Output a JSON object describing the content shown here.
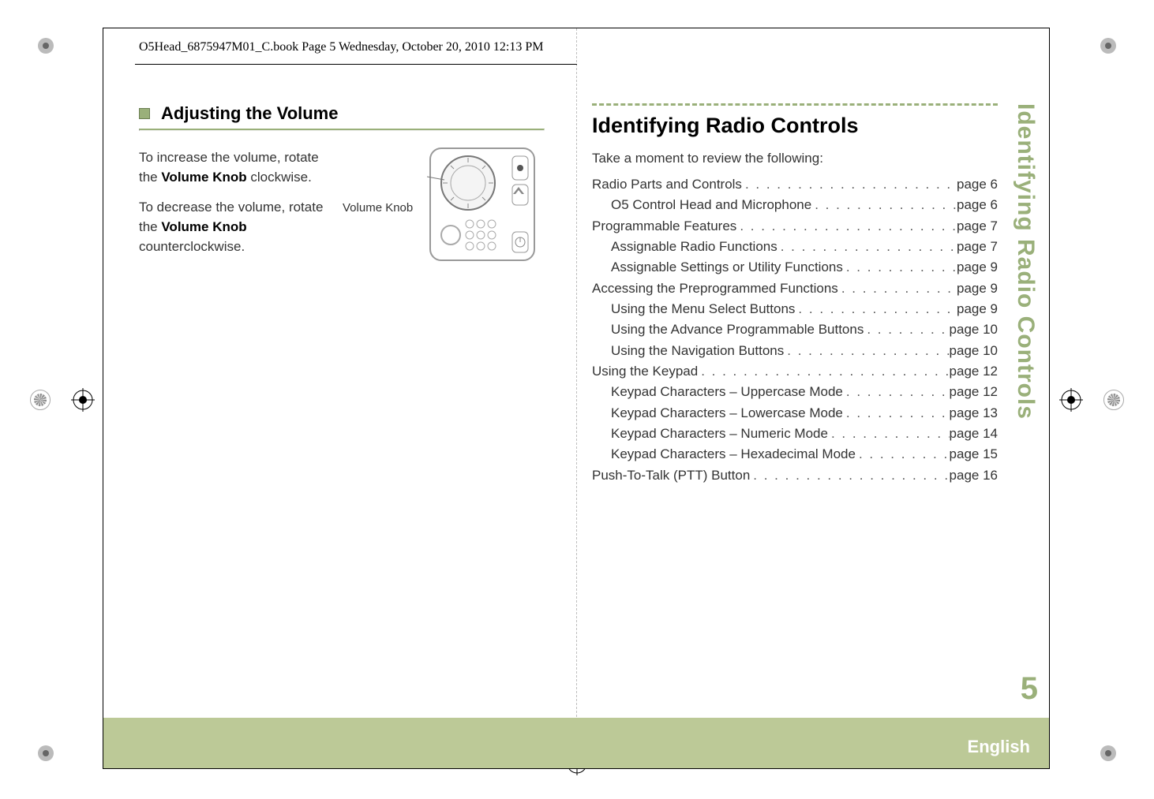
{
  "book_header": "O5Head_6875947M01_C.book  Page 5  Wednesday, October 20, 2010  12:13 PM",
  "left": {
    "heading": "Adjusting the Volume",
    "para1_a": "To increase the volume, rotate the ",
    "para1_b": "Volume Knob",
    "para1_c": " clockwise.",
    "para2_a": "To decrease the volume, rotate the ",
    "para2_b": "Volume Knob",
    "para2_c": " counterclockwise.",
    "knob_label": "Volume Knob"
  },
  "right": {
    "heading": "Identifying Radio Controls",
    "intro": "Take a moment to review the following:",
    "toc": [
      {
        "title": "Radio Parts and Controls",
        "page": "page 6",
        "indent": false
      },
      {
        "title": "O5 Control Head and Microphone",
        "page": "page 6",
        "indent": true
      },
      {
        "title": "Programmable Features",
        "page": "page 7",
        "indent": false
      },
      {
        "title": "Assignable Radio Functions",
        "page": "page 7",
        "indent": true
      },
      {
        "title": "Assignable Settings or Utility Functions",
        "page": "page 9",
        "indent": true
      },
      {
        "title": "Accessing the Preprogrammed Functions",
        "page": "page 9",
        "indent": false
      },
      {
        "title": "Using the Menu Select Buttons",
        "page": "page 9",
        "indent": true
      },
      {
        "title": "Using the Advance Programmable Buttons",
        "page": "page 10",
        "indent": true
      },
      {
        "title": "Using the Navigation Buttons",
        "page": "page 10",
        "indent": true
      },
      {
        "title": "Using the Keypad",
        "page": "page 12",
        "indent": false
      },
      {
        "title": "Keypad Characters – Uppercase Mode",
        "page": "page 12",
        "indent": true
      },
      {
        "title": "Keypad Characters – Lowercase Mode",
        "page": "page 13",
        "indent": true
      },
      {
        "title": "Keypad Characters – Numeric Mode",
        "page": "page 14",
        "indent": true
      },
      {
        "title": "Keypad Characters – Hexadecimal Mode",
        "page": "page 15",
        "indent": true
      },
      {
        "title": "Push-To-Talk (PTT) Button",
        "page": "page 16",
        "indent": false
      }
    ]
  },
  "sidebar_text": "Identifying Radio Controls",
  "page_number": "5",
  "footer_lang": "English"
}
